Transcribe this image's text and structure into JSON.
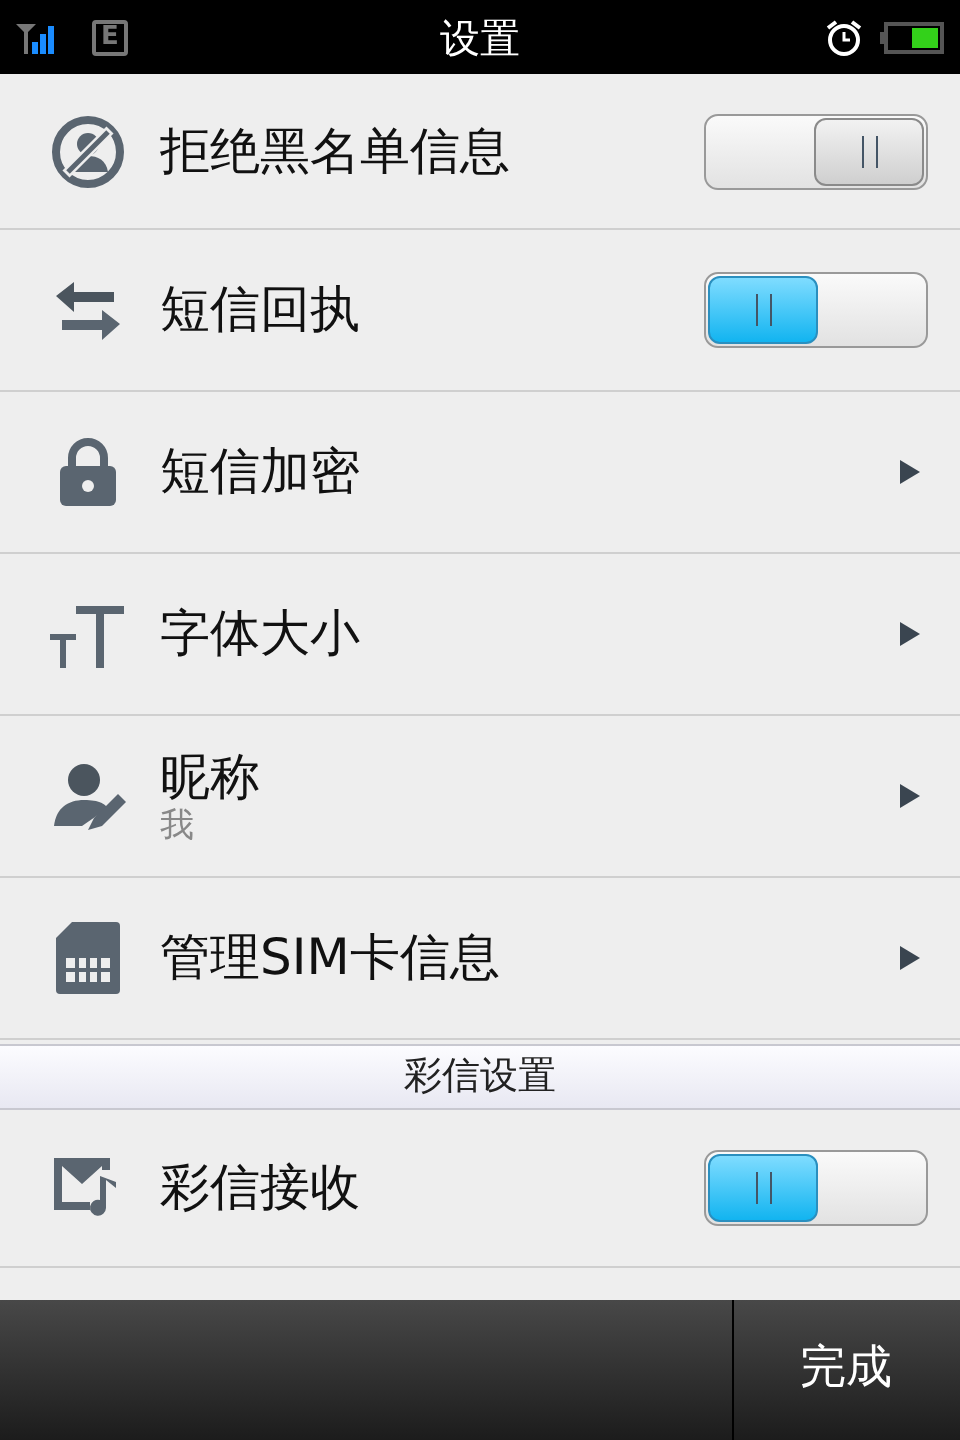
{
  "status_bar": {
    "network": "E",
    "title": "设置"
  },
  "items": [
    {
      "kind": "toggle",
      "label": "拒绝黑名单信息",
      "on": false
    },
    {
      "kind": "toggle",
      "label": "短信回执",
      "on": true
    },
    {
      "kind": "link",
      "label": "短信加密"
    },
    {
      "kind": "link",
      "label": "字体大小"
    },
    {
      "kind": "link",
      "label": "昵称",
      "subtitle": "我"
    },
    {
      "kind": "link",
      "label": "管理SIM卡信息"
    }
  ],
  "section_header": "彩信设置",
  "mms_items": [
    {
      "kind": "toggle",
      "label": "彩信接收",
      "on": true
    }
  ],
  "bottom_bar": {
    "done_button": "完成"
  }
}
